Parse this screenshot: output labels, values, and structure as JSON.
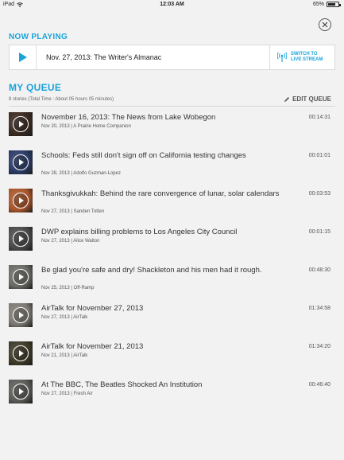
{
  "status_bar": {
    "carrier": "iPad",
    "time": "12:03 AM",
    "battery": "65%"
  },
  "now_playing": {
    "heading": "NOW PLAYING",
    "title": "Nov. 27, 2013: The Writer's Almanac",
    "switch_label": "SWITCH TO LIVE STREAM"
  },
  "queue": {
    "heading": "MY QUEUE",
    "summary": "8 stories (Total Time : About 05 hours 05 minutes)",
    "edit_label": "EDIT QUEUE",
    "items": [
      {
        "title": "November 16, 2013: The News from Lake Wobegon",
        "date": "Nov 20, 2013",
        "source": "A Prairie Home Companion",
        "duration": "00:14:31",
        "thumb_color": "#3a2a22"
      },
      {
        "title": "Schools: Feds still don't sign off on California testing changes",
        "date": "Nov 28, 2013",
        "source": "Adolfo Guzman-Lopez",
        "duration": "00:01:01",
        "thumb_color": "#2b3b66"
      },
      {
        "title": "Thanksgivukkah: Behind the rare convergence of lunar, solar calendars",
        "date": "Nov 27, 2013",
        "source": "Sanden Totten",
        "duration": "00:03:53",
        "thumb_color": "#a8552a"
      },
      {
        "title": "DWP explains billing problems to Los Angeles City Council",
        "date": "Nov 27, 2013",
        "source": "Alice Walton",
        "duration": "00:01:15",
        "thumb_color": "#4a4a4a"
      },
      {
        "title": "Be glad you're safe and dry! Shackleton and his men had it rough.",
        "date": "Nov 25, 2013",
        "source": "Off-Ramp",
        "duration": "00:48:30",
        "thumb_color": "#6a6a66"
      },
      {
        "title": "AirTalk for November 27, 2013",
        "date": "Nov 27, 2013",
        "source": "AirTalk",
        "duration": "01:34:58",
        "thumb_color": "#7c7a72"
      },
      {
        "title": "AirTalk for November 21, 2013",
        "date": "Nov 21, 2013",
        "source": "AirTalk",
        "duration": "01:34:20",
        "thumb_color": "#3e3a28"
      },
      {
        "title": "At The BBC, The Beatles Shocked An Institution",
        "date": "Nov 27, 2013",
        "source": "Fresh Air",
        "duration": "00:46:40",
        "thumb_color": "#5b5b58"
      }
    ]
  },
  "colors": {
    "accent": "#1aa3db",
    "background": "#f2f2f2"
  },
  "icons": {
    "close": "close-icon",
    "play": "play-icon",
    "antenna": "antenna-icon",
    "pencil": "pencil-icon",
    "wifi": "wifi-icon"
  }
}
